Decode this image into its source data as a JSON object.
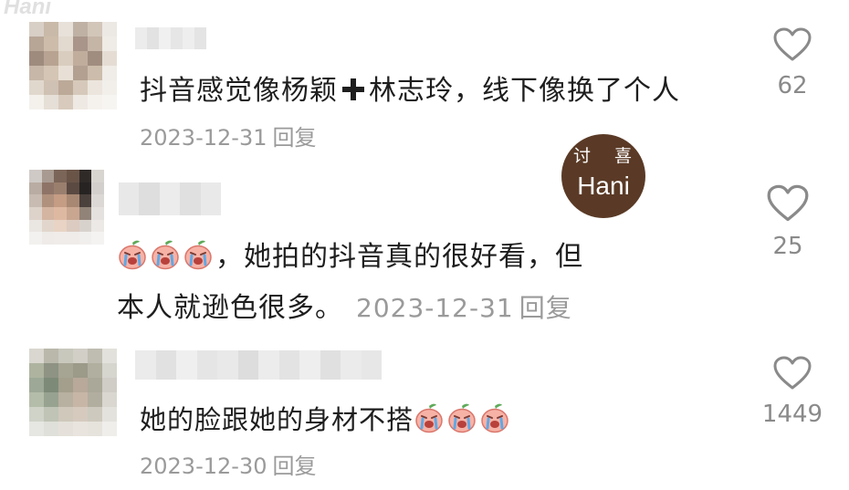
{
  "watermark": {
    "corner_text": "Hani",
    "badge_top": "讨 喜",
    "badge_bottom": "Hani"
  },
  "comments": [
    {
      "text_before": "抖音感觉像杨颖",
      "text_after": "林志玲，线下像换了个人",
      "plus_icon": "heavy-plus-icon",
      "date": "2023-12-31",
      "reply_label": "回复",
      "likes": "62",
      "avatar_colors": [
        "#d8cfc6",
        "#c9b9a8",
        "#e7e1da",
        "#bfb2a5",
        "#d2c6b9",
        "#ece8e3",
        "#b7a596",
        "#cdbcaa",
        "#e2d9cf",
        "#a9958a",
        "#c4b5a6",
        "#efebe6",
        "#9f8b7e",
        "#b8a392",
        "#d9cdbf",
        "#c0ad9c",
        "#a18d80",
        "#e5ddd4",
        "#c7b7a8",
        "#d5c5b4",
        "#e8e0d6",
        "#b3a090",
        "#ccbcab",
        "#f0ece7",
        "#e1d8cd",
        "#cfc1b3",
        "#bca998",
        "#d6c9bb",
        "#ebe5de",
        "#f2efea",
        "#f4f1ed",
        "#e6dfd7",
        "#d8cbbd",
        "#efe9e3",
        "#f5f2ee",
        "#f7f5f2"
      ],
      "name_colors": [
        "#ececec",
        "#e2e2e2",
        "#f0f0f0",
        "#e6e6e6",
        "#eeeeee",
        "#e4e4e4"
      ]
    },
    {
      "text_line1": "，她拍的抖音真的很好看，但",
      "text_line2": "本人就逊色很多。",
      "emoji_icon": "crying-peach-emoji-icon",
      "emoji_count": 3,
      "date": "2023-12-31",
      "reply_label": "回复",
      "likes": "25",
      "avatar_colors": [
        "#cfcac6",
        "#a89a90",
        "#7b6558",
        "#6a5448",
        "#2f2a28",
        "#d8d4d0",
        "#b9aca2",
        "#8e7466",
        "#9a7f6e",
        "#5b4a42",
        "#262322",
        "#d3cfcc",
        "#c8bcb2",
        "#b0917e",
        "#c59c84",
        "#a88873",
        "#4a403c",
        "#dcd8d5",
        "#ddd3cb",
        "#d3b5a2",
        "#deb9a2",
        "#c9a690",
        "#918378",
        "#e4e1de",
        "#eae6e2",
        "#e2d6cc",
        "#e8d3c4",
        "#dccbc0",
        "#d8d2cd",
        "#ece9e6",
        "#f3f1ef",
        "#eeebe8",
        "#f0ece9",
        "#efece9",
        "#f1efed",
        "#f5f3f2"
      ],
      "name_colors": [
        "#e8e8e8",
        "#dedede",
        "#ececec",
        "#e0e0e0",
        "#e9e9e9"
      ]
    },
    {
      "text": "她的脸跟她的身材不搭",
      "emoji_icon": "crying-peach-emoji-icon",
      "emoji_count": 3,
      "date": "2023-12-30",
      "reply_label": "回复",
      "likes": "1449",
      "avatar_colors": [
        "#d9d7cf",
        "#b9b8ab",
        "#c9c8bd",
        "#d1cfc6",
        "#bfbdb1",
        "#e2e1db",
        "#aeb39f",
        "#8e9384",
        "#a6a493",
        "#9c9a89",
        "#b1af9f",
        "#d6d5ce",
        "#9da996",
        "#7e8a78",
        "#a39f8c",
        "#b8a99a",
        "#aaa898",
        "#cfcdc5",
        "#b4bda9",
        "#98a290",
        "#b8b0a0",
        "#c7b6a6",
        "#b2ae9f",
        "#d9d7d0",
        "#cfd3c8",
        "#c0c4b6",
        "#cfc8bb",
        "#d6cabf",
        "#cdc9be",
        "#e4e2dd",
        "#e6e7e2",
        "#dfe0d9",
        "#e5e1da",
        "#e9e4de",
        "#e6e3dd",
        "#efeeea"
      ],
      "name_colors": [
        "#ebebeb",
        "#e1e1e1",
        "#efefef",
        "#e5e5e5",
        "#e9e9e9",
        "#dddddd",
        "#ececec",
        "#e3e3e3",
        "#eeeeee",
        "#e0e0e0",
        "#ebebeb",
        "#e7e7e7"
      ]
    }
  ],
  "icons": {
    "heart": "heart-outline-icon",
    "emoji": "crying-peach-emoji-icon"
  },
  "colors": {
    "text": "#1e1e1e",
    "meta": "#9a9a9a",
    "count": "#8a8a8a",
    "badge": "#5a3a26"
  }
}
